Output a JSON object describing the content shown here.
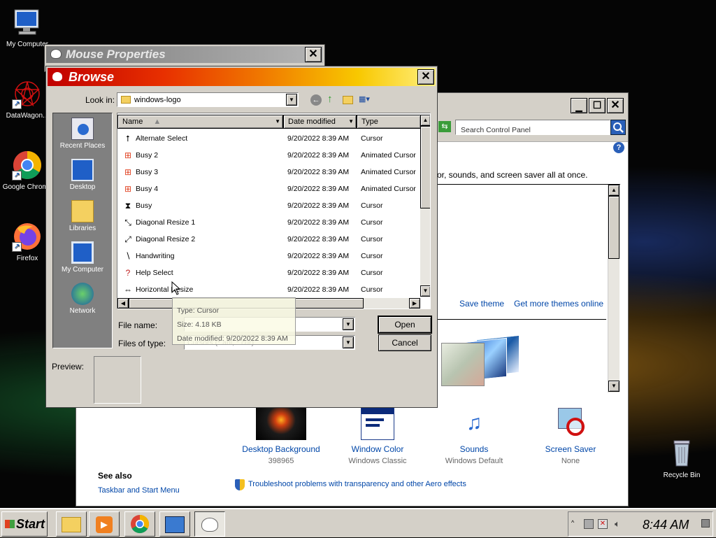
{
  "desktop": {
    "icons": [
      {
        "label": "My Computer"
      },
      {
        "label": "DataWagon..."
      },
      {
        "label": "Google Chrome"
      },
      {
        "label": "Firefox"
      },
      {
        "label": "Recycle Bin"
      }
    ]
  },
  "control_panel": {
    "search_placeholder": "Search Control Panel",
    "help": "?",
    "description": "or, sounds, and screen saver all at once.",
    "save_theme": "Save theme",
    "get_more_themes": "Get more themes online",
    "items": [
      {
        "label": "Desktop Background",
        "value": "398965"
      },
      {
        "label": "Window Color",
        "value": "Windows Classic"
      },
      {
        "label": "Sounds",
        "value": "Windows Default"
      },
      {
        "label": "Screen Saver",
        "value": "None"
      }
    ],
    "see_also_title": "See also",
    "see_also_link": "Taskbar and Start Menu",
    "troubleshoot": "Troubleshoot problems with transparency and other Aero effects"
  },
  "mouse_properties": {
    "title": "Mouse Properties"
  },
  "browse": {
    "title": "Browse",
    "look_in_label": "Look in:",
    "look_in_value": "windows-logo",
    "places": [
      {
        "label": "Recent Places"
      },
      {
        "label": "Desktop"
      },
      {
        "label": "Libraries"
      },
      {
        "label": "My Computer"
      },
      {
        "label": "Network"
      }
    ],
    "columns": {
      "name": "Name",
      "date": "Date modified",
      "type": "Type"
    },
    "files": [
      {
        "name": "Alternate Select",
        "date": "9/20/2022 8:39 AM",
        "type": "Cursor"
      },
      {
        "name": "Busy 2",
        "date": "9/20/2022 8:39 AM",
        "type": "Animated Cursor"
      },
      {
        "name": "Busy 3",
        "date": "9/20/2022 8:39 AM",
        "type": "Animated Cursor"
      },
      {
        "name": "Busy 4",
        "date": "9/20/2022 8:39 AM",
        "type": "Animated Cursor"
      },
      {
        "name": "Busy",
        "date": "9/20/2022 8:39 AM",
        "type": "Cursor"
      },
      {
        "name": "Diagonal Resize 1",
        "date": "9/20/2022 8:39 AM",
        "type": "Cursor"
      },
      {
        "name": "Diagonal Resize 2",
        "date": "9/20/2022 8:39 AM",
        "type": "Cursor"
      },
      {
        "name": "Handwriting",
        "date": "9/20/2022 8:39 AM",
        "type": "Cursor"
      },
      {
        "name": "Help Select",
        "date": "9/20/2022 8:39 AM",
        "type": "Cursor"
      },
      {
        "name": "Horizontal Resize",
        "date": "9/20/2022 8:39 AM",
        "type": "Cursor"
      }
    ],
    "file_name_label": "File name:",
    "file_name_value": "",
    "files_of_type_label": "Files of type:",
    "files_of_type_value": "Cursors (*.ani, *.cur)",
    "open": "Open",
    "cancel": "Cancel",
    "preview_label": "Preview:",
    "tooltip": {
      "type": "Type: Cursor",
      "size": "Size: 4.18 KB",
      "date": "Date modified: 9/20/2022 8:39 AM"
    }
  },
  "taskbar": {
    "start": "Start",
    "clock": "8:44 AM"
  }
}
